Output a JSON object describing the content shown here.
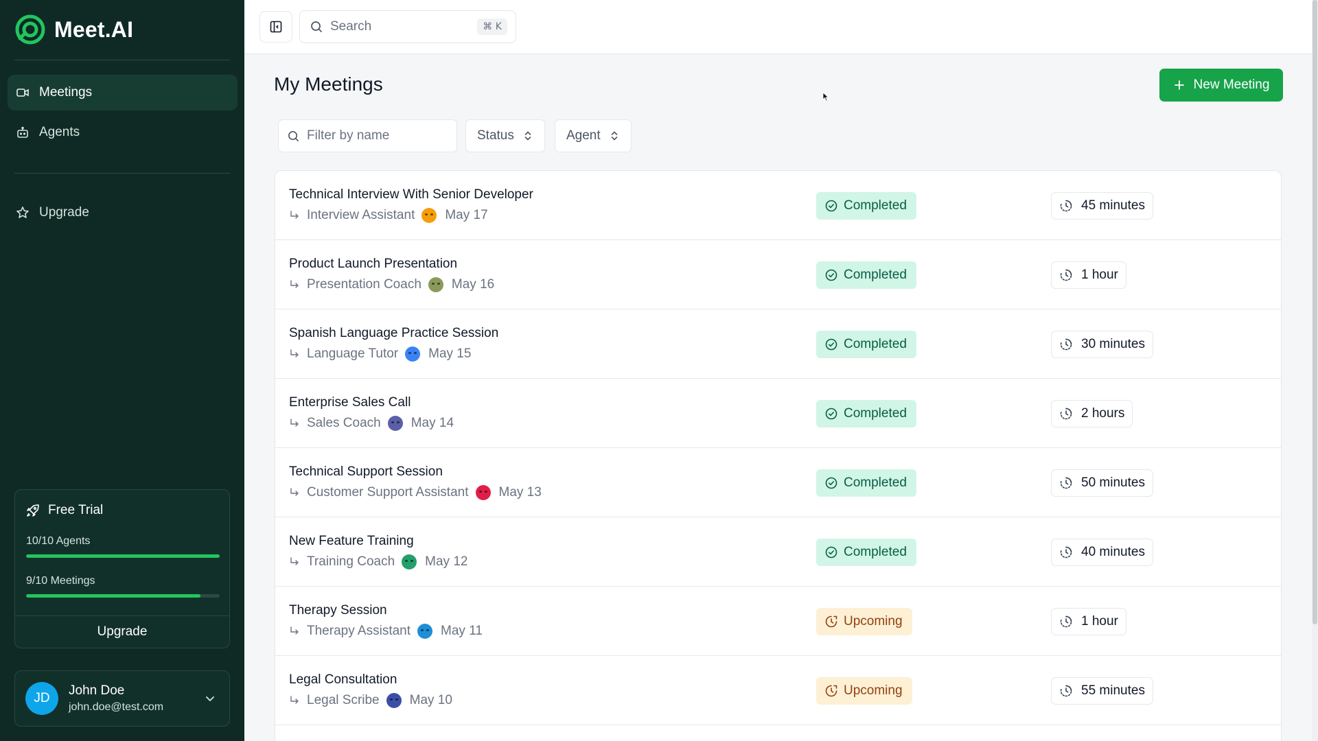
{
  "app": {
    "name": "Meet.AI"
  },
  "sidebar": {
    "nav": [
      {
        "label": "Meetings",
        "icon": "video-icon",
        "active": true
      },
      {
        "label": "Agents",
        "icon": "bot-icon",
        "active": false
      }
    ],
    "secondary": [
      {
        "label": "Upgrade",
        "icon": "star-icon"
      }
    ],
    "trial": {
      "title": "Free Trial",
      "agents_label": "10/10 Agents",
      "agents_progress": 1.0,
      "meetings_label": "9/10 Meetings",
      "meetings_progress": 0.9,
      "upgrade_label": "Upgrade"
    },
    "user": {
      "initials": "JD",
      "name": "John Doe",
      "email": "john.doe@test.com"
    }
  },
  "topbar": {
    "search_placeholder": "Search",
    "shortcut": "⌘ K"
  },
  "main": {
    "title": "My Meetings",
    "new_button": "New Meeting",
    "filters": {
      "name_placeholder": "Filter by name",
      "status_label": "Status",
      "agent_label": "Agent"
    },
    "meetings": [
      {
        "title": "Technical Interview With Senior Developer",
        "agent": "Interview Assistant",
        "agent_color": "#f59e0b",
        "date": "May 17",
        "status": "Completed",
        "duration": "45 minutes"
      },
      {
        "title": "Product Launch Presentation",
        "agent": "Presentation Coach",
        "agent_color": "#8a9a5b",
        "date": "May 16",
        "status": "Completed",
        "duration": "1 hour"
      },
      {
        "title": "Spanish Language Practice Session",
        "agent": "Language Tutor",
        "agent_color": "#3b82f6",
        "date": "May 15",
        "status": "Completed",
        "duration": "30 minutes"
      },
      {
        "title": "Enterprise Sales Call",
        "agent": "Sales Coach",
        "agent_color": "#5b5fa8",
        "date": "May 14",
        "status": "Completed",
        "duration": "2 hours"
      },
      {
        "title": "Technical Support Session",
        "agent": "Customer Support Assistant",
        "agent_color": "#e11d48",
        "date": "May 13",
        "status": "Completed",
        "duration": "50 minutes"
      },
      {
        "title": "New Feature Training",
        "agent": "Training Coach",
        "agent_color": "#22a06b",
        "date": "May 12",
        "status": "Completed",
        "duration": "40 minutes"
      },
      {
        "title": "Therapy Session",
        "agent": "Therapy Assistant",
        "agent_color": "#1d8fd6",
        "date": "May 11",
        "status": "Upcoming",
        "duration": "1 hour"
      },
      {
        "title": "Legal Consultation",
        "agent": "Legal Scribe",
        "agent_color": "#3b4fa8",
        "date": "May 10",
        "status": "Upcoming",
        "duration": "55 minutes"
      }
    ]
  },
  "colors": {
    "sidebar_bg": "#0f2a24",
    "accent_green": "#16a34a",
    "completed_bg": "#d1f5e6",
    "upcoming_bg": "#fdf0d5"
  }
}
